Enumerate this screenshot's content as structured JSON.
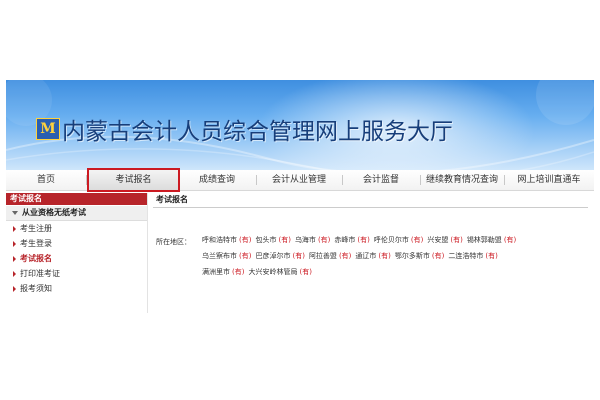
{
  "header": {
    "logo_text": "M",
    "title": "内蒙古会计人员综合管理网上服务大厅"
  },
  "nav": {
    "items": [
      "首页",
      "考试报名",
      "成绩查询",
      "会计从业管理",
      "会计监督",
      "继续教育情况查询",
      "网上培训直通车"
    ],
    "active_index": 1
  },
  "sidebar": {
    "header": "考试报名",
    "group": "从业资格无纸考试",
    "items": [
      "考生注册",
      "考生登录",
      "考试报名",
      "打印准考证",
      "报考须知"
    ],
    "active_index": 2
  },
  "main": {
    "title": "考试报名",
    "region_label": "所在地区：",
    "badge_text": "(有)",
    "regions": [
      "呼和浩特市",
      "包头市",
      "乌海市",
      "赤峰市",
      "呼伦贝尔市",
      "兴安盟",
      "锡林郭勒盟",
      "乌兰察布市",
      "巴彦淖尔市",
      "阿拉善盟",
      "通辽市",
      "鄂尔多斯市",
      "二连浩特市",
      "满洲里市",
      "大兴安岭林管局"
    ]
  },
  "colors": {
    "banner_top": "#3f8fe0",
    "accent_red": "#b7242a",
    "highlight_border": "#cc1a22",
    "title_blue": "#173e7a"
  }
}
